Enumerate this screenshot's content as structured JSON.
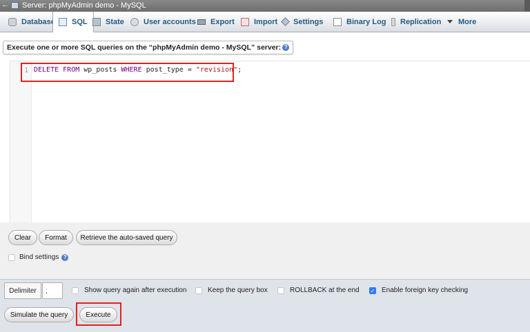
{
  "window": {
    "title": "Server: phpMyAdmin demo - MySQL",
    "back_glyph": "←"
  },
  "tabs": [
    {
      "label": "Databases",
      "icon": "database-icon",
      "active": false
    },
    {
      "label": "SQL",
      "icon": "sql-icon",
      "active": true
    },
    {
      "label": "State",
      "icon": "status-icon",
      "active": false
    },
    {
      "label": "User accounts",
      "icon": "users-icon",
      "active": false
    },
    {
      "label": "Export",
      "icon": "export-icon",
      "active": false
    },
    {
      "label": "Import",
      "icon": "import-icon",
      "active": false
    },
    {
      "label": "Settings",
      "icon": "settings-icon",
      "active": false
    },
    {
      "label": "Binary Log",
      "icon": "binary-log-icon",
      "active": false
    },
    {
      "label": "Replication",
      "icon": "replication-icon",
      "active": false
    },
    {
      "label": "More",
      "icon": "chevron-down-icon",
      "active": false
    }
  ],
  "query_panel": {
    "title": "Execute one or more SQL queries on the “phpMyAdmin demo - MySQL” server:",
    "help_glyph": "?",
    "line_number": "1",
    "code": {
      "kw1": "DELETE",
      "kw2": "FROM",
      "table": "wp_posts",
      "kw3": "WHERE",
      "cond": "post_type =",
      "value": "\"revision\"",
      "terminator": ";"
    }
  },
  "editor_buttons": {
    "clear": "Clear",
    "format": "Format",
    "retrieve": "Retrieve the auto-saved query"
  },
  "bind_settings": {
    "label": "Bind settings",
    "checked": false
  },
  "execution": {
    "delimiter_label": "Delimiter",
    "delimiter_value": ";",
    "options": [
      {
        "label": "Show query again after execution",
        "checked": false
      },
      {
        "label": "Keep the query box",
        "checked": false
      },
      {
        "label": "ROLLBACK at the end",
        "checked": false
      },
      {
        "label": "Enable foreign key checking",
        "checked": true
      }
    ],
    "simulate_label": "Simulate the query",
    "execute_label": "Execute",
    "checkmark": "✓"
  },
  "colors": {
    "tab_text": "#235a81",
    "keyword": "#770088",
    "string": "#aa1111",
    "highlight": "#e02020",
    "checkbox_checked": "#2f7cf6"
  }
}
